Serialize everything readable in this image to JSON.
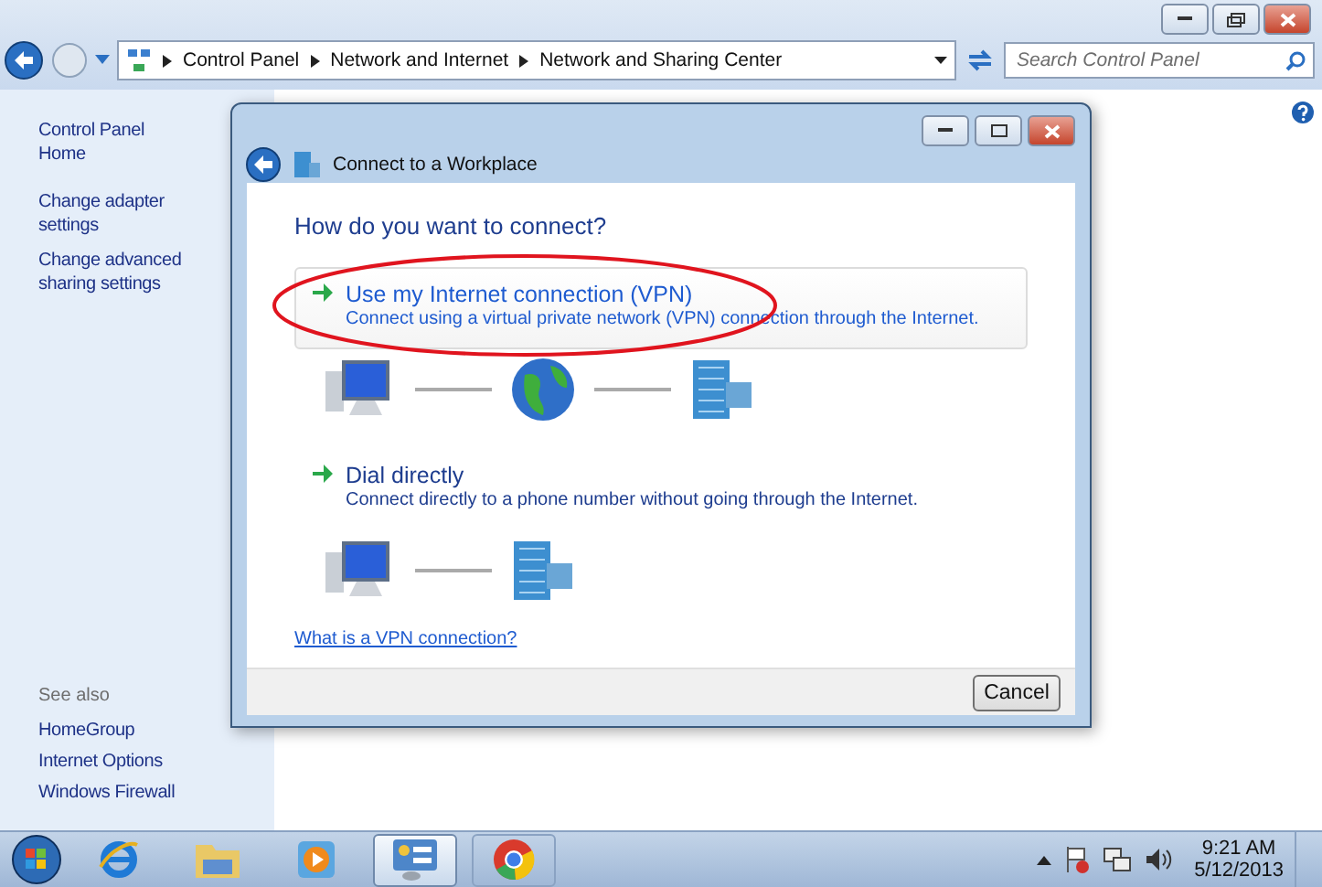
{
  "address_bar": {
    "breadcrumbs": [
      "Control Panel",
      "Network and Internet",
      "Network and Sharing Center"
    ]
  },
  "search": {
    "placeholder": "Search Control Panel"
  },
  "sidebar": {
    "links": [
      "Control Panel Home",
      "Change adapter settings",
      "Change advanced sharing settings"
    ],
    "see_also_heading": "See also",
    "see_also": [
      "HomeGroup",
      "Internet Options",
      "Windows Firewall"
    ]
  },
  "dialog": {
    "title": "Connect to a Workplace",
    "heading": "How do you want to connect?",
    "options": [
      {
        "title": "Use my Internet connection (VPN)",
        "description": "Connect using a virtual private network (VPN) connection through the Internet.",
        "highlighted": true,
        "circled": true,
        "kind": "vpn"
      },
      {
        "title": "Dial directly",
        "description": "Connect directly to a phone number without going through the Internet.",
        "highlighted": false,
        "circled": false,
        "kind": "direct"
      }
    ],
    "link": "What is a VPN connection?",
    "buttons": [
      "Cancel"
    ]
  },
  "taskbar": {
    "items": [
      {
        "kind": "ie",
        "selected": false
      },
      {
        "kind": "folder",
        "selected": false
      },
      {
        "kind": "media",
        "selected": false
      },
      {
        "kind": "control-panel",
        "selected": true
      },
      {
        "kind": "chrome",
        "selected": false
      }
    ],
    "clock": {
      "time": "9:21 AM",
      "date": "5/12/2013"
    }
  }
}
